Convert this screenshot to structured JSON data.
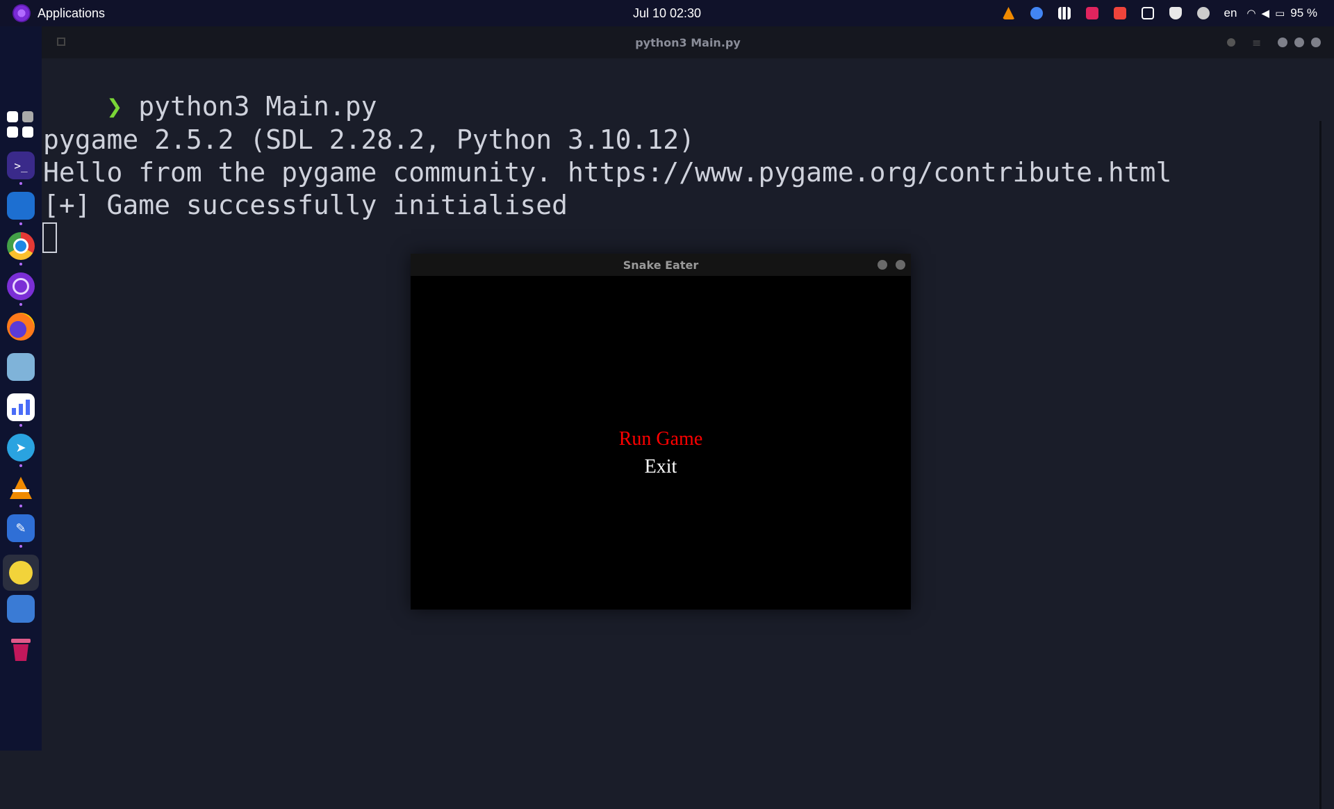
{
  "topbar": {
    "apps_label": "Applications",
    "clock": "Jul 10  02:30",
    "lang": "en",
    "battery": "95 %",
    "tray_icons": [
      "vlc-icon",
      "chrome-remote-icon",
      "chart-icon",
      "ruby-icon",
      "anydesk-icon",
      "screen-icon",
      "shield-icon"
    ]
  },
  "dock": {
    "items": [
      "app-grid-icon",
      "terminal-icon",
      "files-icon",
      "chrome-icon",
      "tor-icon",
      "firefox-icon",
      "anime-app-icon",
      "analytics-icon",
      "telegram-icon",
      "vlc-icon",
      "editor-icon",
      "pygame-icon",
      "remmina-icon",
      "trash-icon"
    ]
  },
  "terminal": {
    "title": "python3 Main.py",
    "prompt_symbol": "❯",
    "command": "python3 Main.py",
    "output": [
      "pygame 2.5.2 (SDL 2.28.2, Python 3.10.12)",
      "Hello from the pygame community. https://www.pygame.org/contribute.html",
      "[+] Game successfully initialised"
    ]
  },
  "game": {
    "title": "Snake Eater",
    "menu_run": "Run Game",
    "menu_exit": "Exit",
    "colors": {
      "selected": "#ff0000",
      "normal": "#ffffff"
    }
  }
}
